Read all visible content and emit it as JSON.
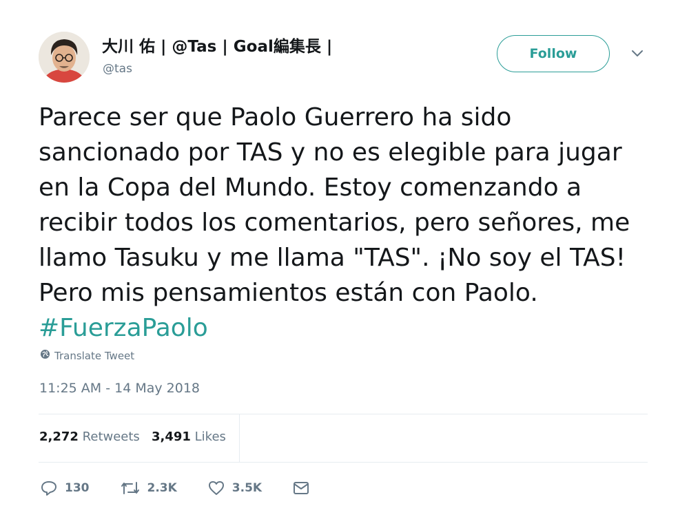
{
  "header": {
    "display_name": "大川 佑 | @Tas | Goal編集長 |",
    "handle": "@tas",
    "follow_label": "Follow",
    "caret_icon": "chevron-down-icon"
  },
  "tweet": {
    "text": "Parece ser que Paolo Guerrero ha sido sancionado por TAS y no es elegible para jugar en la Copa del Mundo. Estoy comenzando a recibir todos los comentarios, pero señores, me llamo Tasuku y me llama \"TAS\". ¡No soy el TAS! Pero mis pensamientos están con Paolo.",
    "hashtag": "#FuerzaPaolo",
    "translate_label": "Translate Tweet",
    "timestamp": "11:25 AM - 14 May 2018"
  },
  "stats": {
    "retweets_count": "2,272",
    "retweets_label": "Retweets",
    "likes_count": "3,491",
    "likes_label": "Likes"
  },
  "actions": {
    "reply_count": "130",
    "retweet_count": "2.3K",
    "like_count": "3.5K"
  },
  "colors": {
    "accent": "#2a9d97",
    "muted": "#657786",
    "text": "#14171a",
    "divider": "#e6ecf0"
  }
}
